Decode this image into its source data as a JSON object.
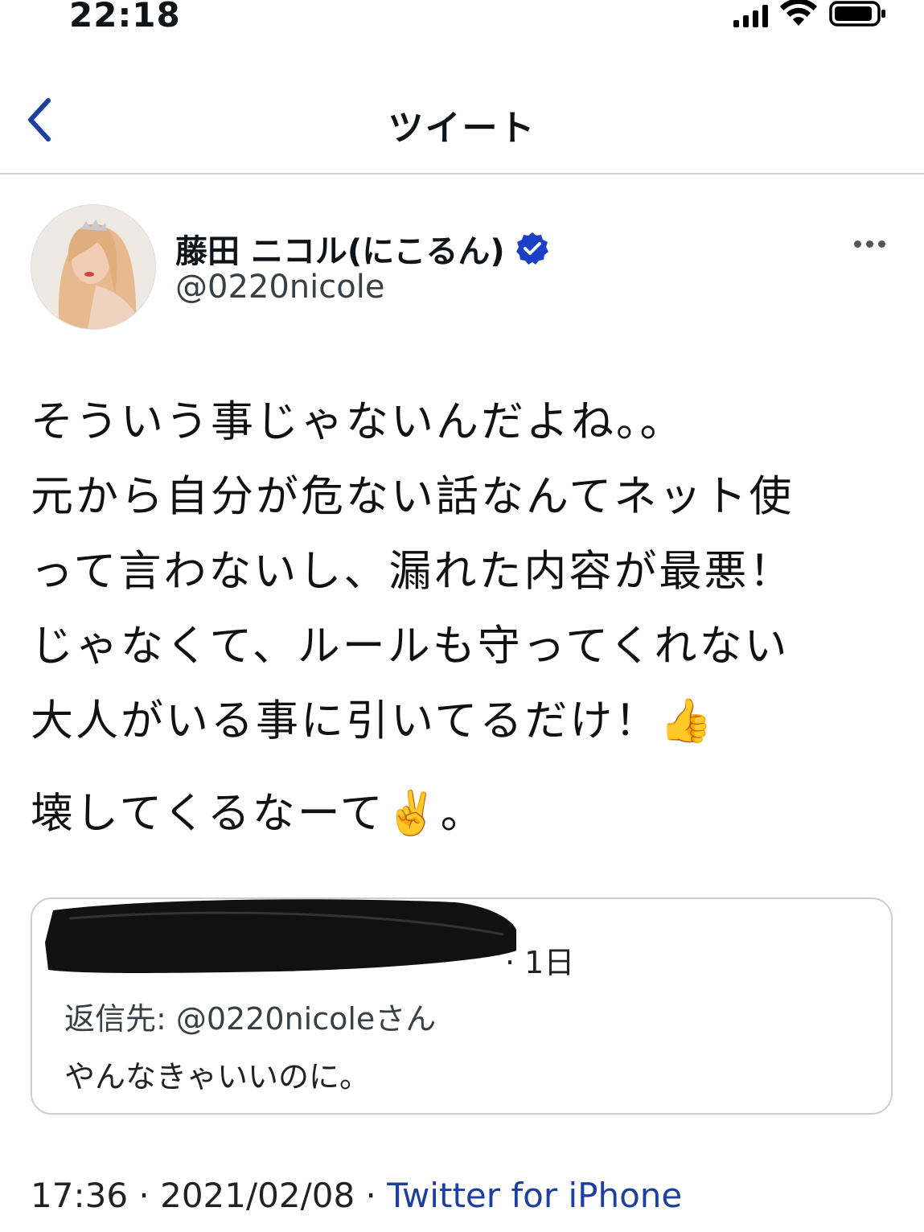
{
  "status_bar": {
    "time": "22:18"
  },
  "nav": {
    "title": "ツイート",
    "back_icon": "chevron-left-icon",
    "accent_color": "#1d3f9e"
  },
  "tweet": {
    "author_name": "藤田 ニコル(にこるん)",
    "author_handle": "@0220nicole",
    "verified_color": "#1a40c8",
    "body_lines": [
      "そういう事じゃないんだよね。。",
      "元から自分が危ない話なんてネット使",
      "って言わないし、漏れた内容が最悪！",
      "じゃなくて、ルールも守ってくれない",
      "大人がいる事に引いてるだけ！👍",
      "壊してくるなーて✌️。"
    ],
    "quoted": {
      "time_ago": "1日",
      "reply_to": "返信先: @0220nicoleさん",
      "text": "やんなきゃいいのに。"
    },
    "meta": {
      "time": "17:36",
      "date": "2021/02/08",
      "separator": " · ",
      "source": "Twitter for iPhone"
    }
  }
}
